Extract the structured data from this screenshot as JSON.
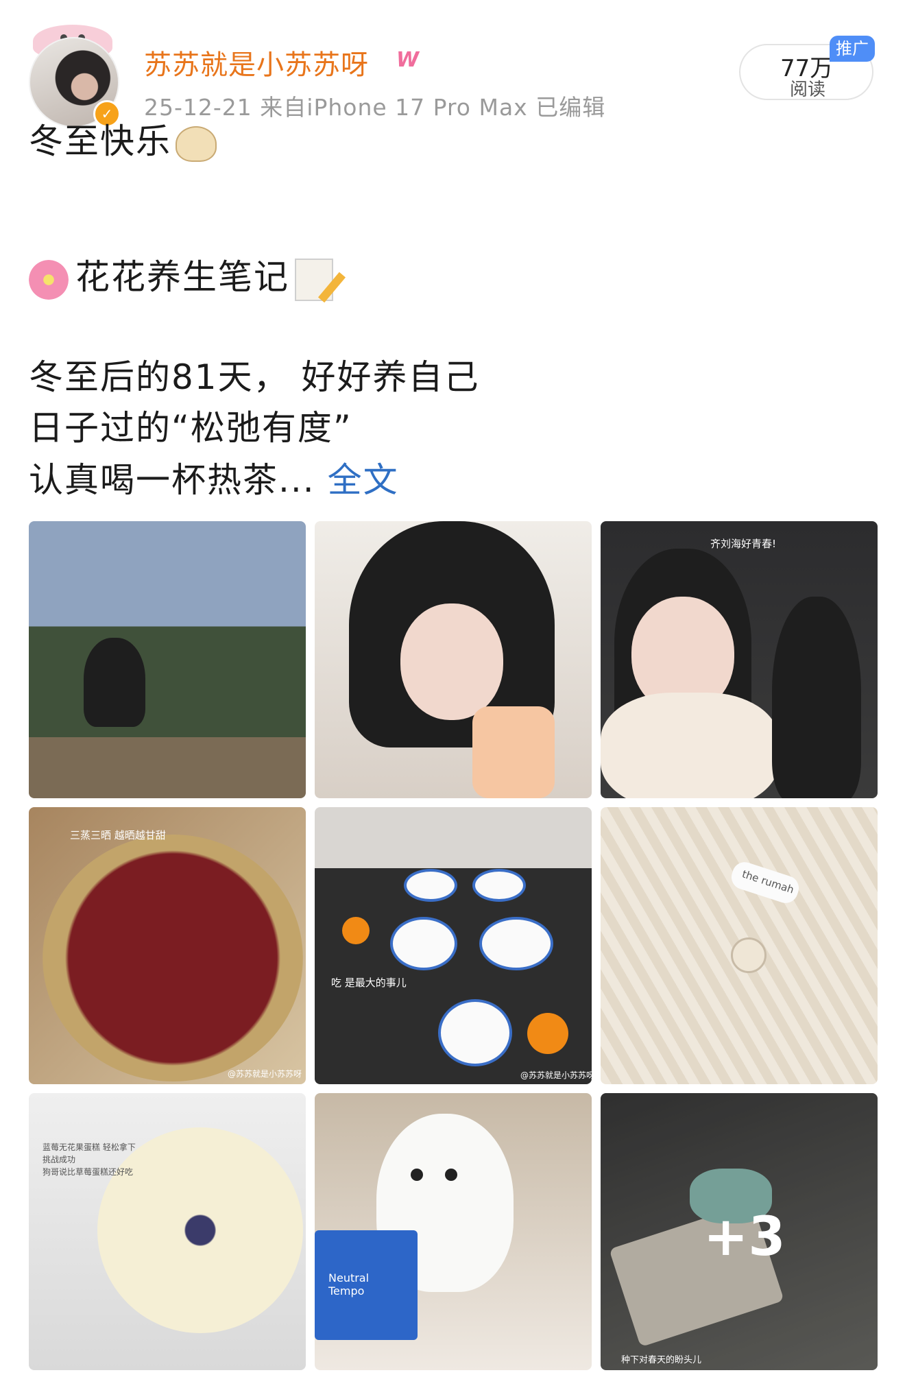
{
  "post": {
    "username": "苏苏就是小苏苏呀",
    "vip_mark": "W",
    "meta": "25-12-21  来自iPhone 17 Pro Max  已编辑",
    "reads": {
      "count": "77万",
      "label": "阅读",
      "promo": "推广"
    },
    "lines": {
      "line1": "冬至快乐",
      "line2": "花花养生笔记",
      "line3": "冬至后的81天， 好好养自己",
      "line4": "日子过的“松弛有度”",
      "line5": "认真喝一杯热茶...",
      "fulltext": "全文"
    },
    "images": {
      "captions": {
        "c3": "齐刘海好青春!",
        "c4": "三蒸三晒 越晒越甘甜",
        "c4_wm": "@苏苏就是小苏苏呀",
        "c5": "吃 是最大的事儿",
        "c5_wm": "@苏苏就是小苏苏呀",
        "c6_label": "the rumah",
        "c7": "蓝莓无花果蛋糕 轻松拿下\n挑战成功\n狗哥说比草莓蛋糕还好吃",
        "c8_tissue": "Neutral\nTempo",
        "c9": "种下对春天的盼头儿"
      },
      "more": "+3"
    }
  }
}
